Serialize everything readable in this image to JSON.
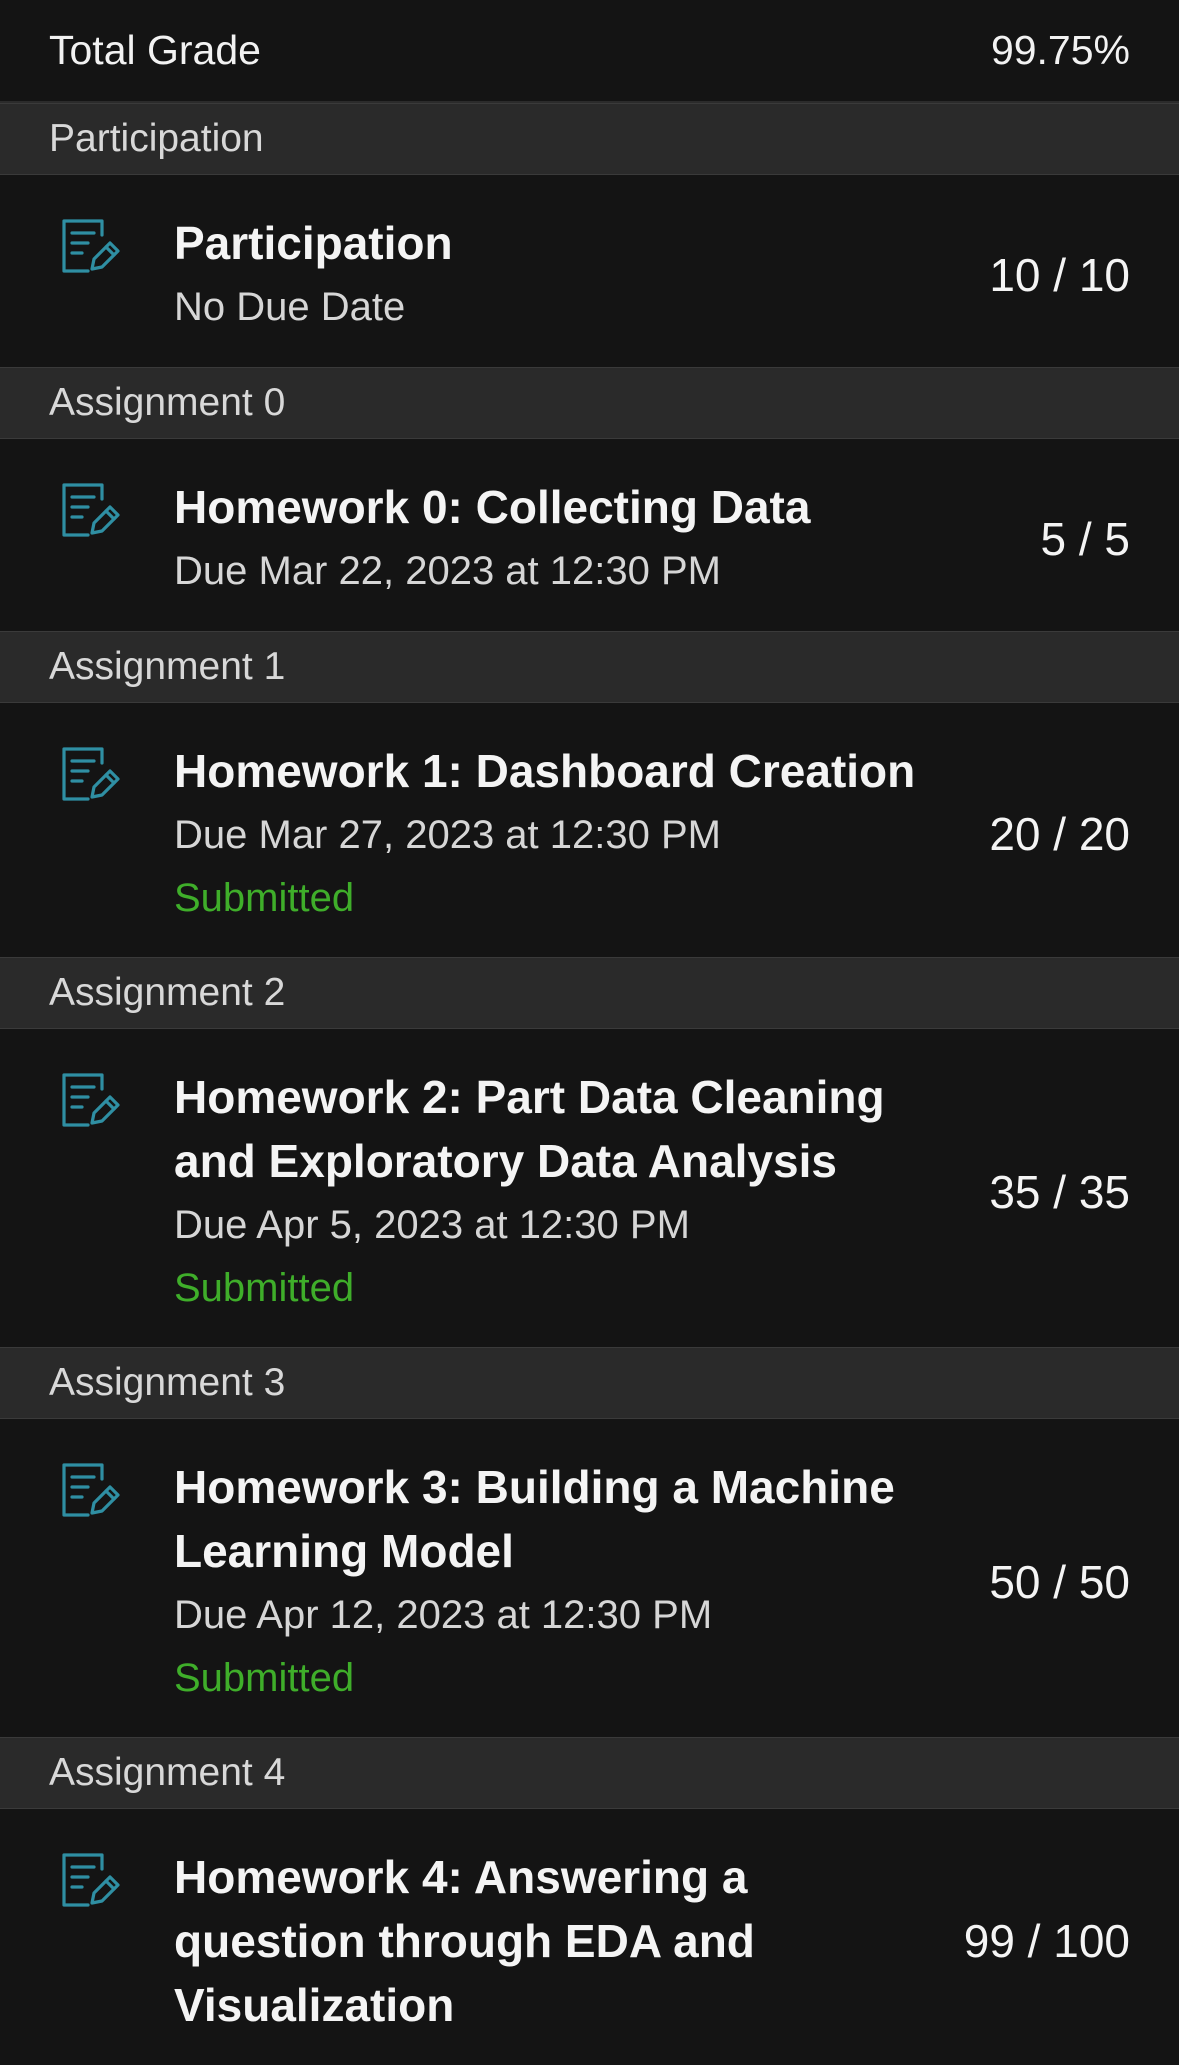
{
  "total": {
    "label": "Total Grade",
    "value": "99.75%"
  },
  "groups": [
    {
      "header": "Participation",
      "item": {
        "title": "Participation",
        "due": "No Due Date",
        "status": "",
        "score": "10 / 10",
        "icon": "assignment-icon"
      }
    },
    {
      "header": "Assignment 0",
      "item": {
        "title": "Homework 0: Collecting Data",
        "due": "Due Mar 22, 2023 at 12:30 PM",
        "status": "",
        "score": "5 / 5",
        "icon": "assignment-icon"
      }
    },
    {
      "header": "Assignment 1",
      "item": {
        "title": "Homework 1: Dashboard Creation",
        "due": "Due Mar 27, 2023 at 12:30 PM",
        "status": "Submitted",
        "score": "20 / 20",
        "icon": "assignment-icon"
      }
    },
    {
      "header": "Assignment 2",
      "item": {
        "title": "Homework 2: Part Data Cleaning and  Exploratory Data Analysis",
        "due": "Due Apr 5, 2023 at 12:30 PM",
        "status": "Submitted",
        "score": "35 / 35",
        "icon": "assignment-icon"
      }
    },
    {
      "header": "Assignment 3",
      "item": {
        "title": "Homework 3: Building a Machine Learning Model",
        "due": "Due Apr 12, 2023 at 12:30 PM",
        "status": "Submitted",
        "score": "50 / 50",
        "icon": "assignment-icon"
      }
    },
    {
      "header": "Assignment 4",
      "item": {
        "title": "Homework 4: Answering a question through EDA and Visualization",
        "due": "",
        "status": "",
        "score": "99 / 100",
        "icon": "assignment-icon"
      }
    }
  ],
  "colors": {
    "background": "#141414",
    "group_header_bg": "#2a2a2a",
    "icon_teal": "#2f8fa3",
    "submitted_green": "#3fae2a"
  }
}
